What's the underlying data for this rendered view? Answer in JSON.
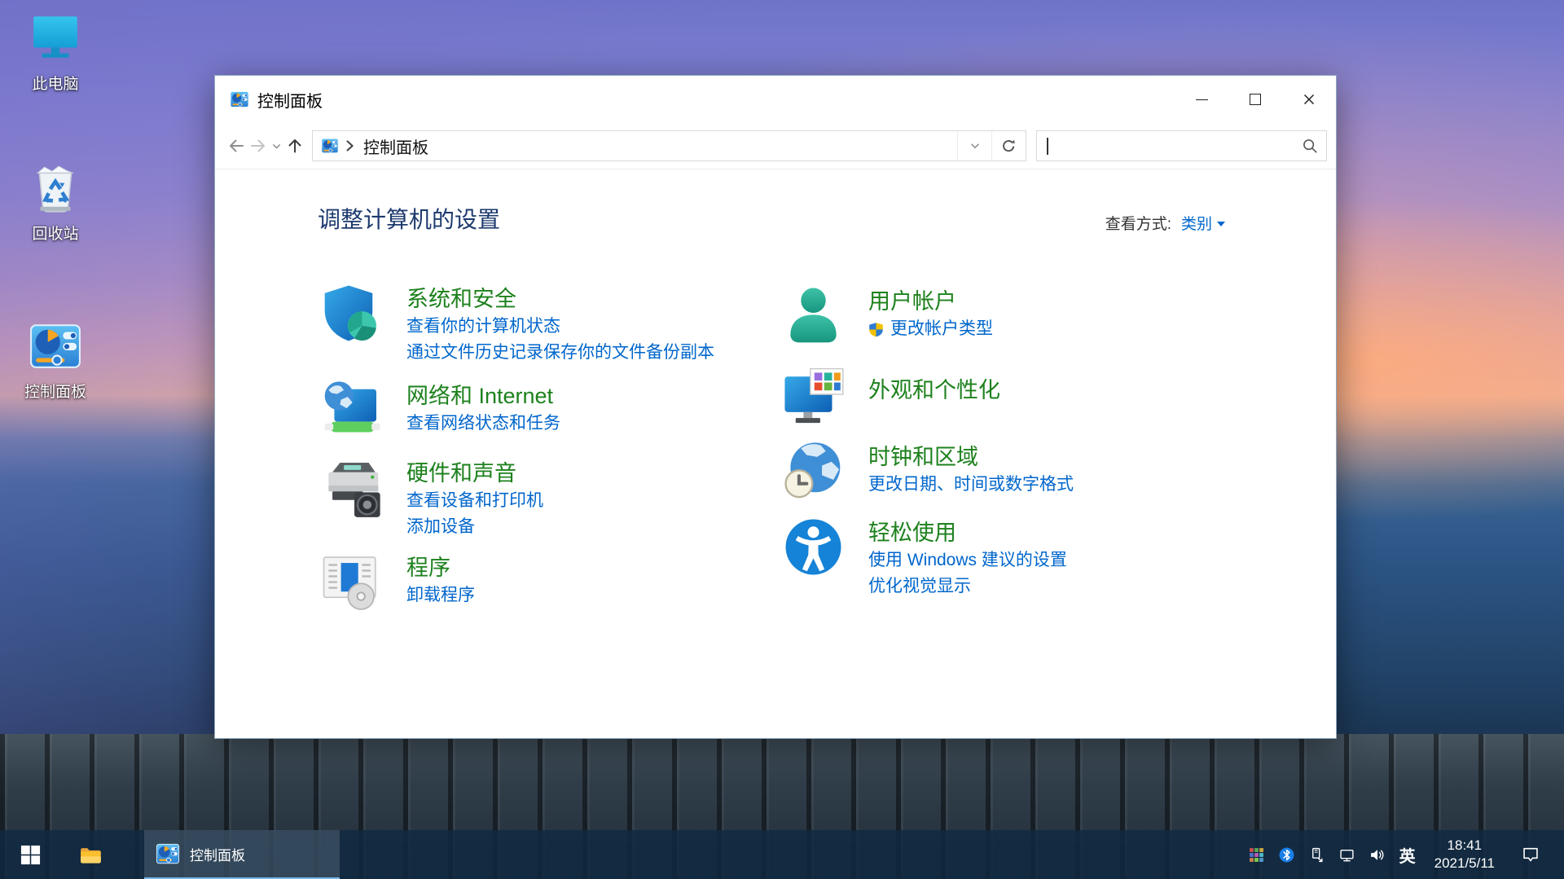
{
  "desktop": {
    "icons": [
      {
        "label": "此电脑"
      },
      {
        "label": "回收站"
      },
      {
        "label": "控制面板"
      }
    ]
  },
  "window": {
    "title": "控制面板"
  },
  "nav": {
    "breadcrumb_root": "控制面板",
    "search_placeholder": ""
  },
  "content": {
    "heading": "调整计算机的设置",
    "view_by_label": "查看方式:",
    "view_by_value": "类别"
  },
  "categories": {
    "left": [
      {
        "title": "系统和安全",
        "links": [
          "查看你的计算机状态",
          "通过文件历史记录保存你的文件备份副本"
        ]
      },
      {
        "title": "网络和 Internet",
        "links": [
          "查看网络状态和任务"
        ]
      },
      {
        "title": "硬件和声音",
        "links": [
          "查看设备和打印机",
          "添加设备"
        ]
      },
      {
        "title": "程序",
        "links": [
          "卸载程序"
        ]
      }
    ],
    "right": [
      {
        "title": "用户帐户",
        "links": [
          "更改帐户类型"
        ],
        "uac_shield_on_link": true
      },
      {
        "title": "外观和个性化",
        "links": []
      },
      {
        "title": "时钟和区域",
        "links": [
          "更改日期、时间或数字格式"
        ]
      },
      {
        "title": "轻松使用",
        "links": [
          "使用 Windows 建议的设置",
          "优化视觉显示"
        ]
      }
    ]
  },
  "taskbar": {
    "app_button": "控制面板",
    "language": "英",
    "time": "18:41",
    "date": "2021/5/11"
  },
  "icons": {
    "window_controls": [
      "minimize",
      "maximize",
      "close"
    ],
    "nav": [
      "back-arrow",
      "forward-arrow",
      "chevron-down",
      "up-arrow",
      "refresh",
      "search-magnifier"
    ],
    "tray": [
      "app-grid",
      "bluetooth",
      "usb-device",
      "network",
      "speaker",
      "action-center"
    ],
    "category": [
      "shield-pie",
      "monitor-globe",
      "printer-speaker",
      "programs-disc",
      "user-silhouette",
      "monitor-palette",
      "globe-clock",
      "accessibility-circle"
    ]
  },
  "colors": {
    "category_title_green": "#1d811d",
    "link_blue": "#0066cc",
    "heading_navy": "#1d3a6e",
    "taskbar_bg": "#102a42",
    "accent_orange": "#f5a623"
  }
}
